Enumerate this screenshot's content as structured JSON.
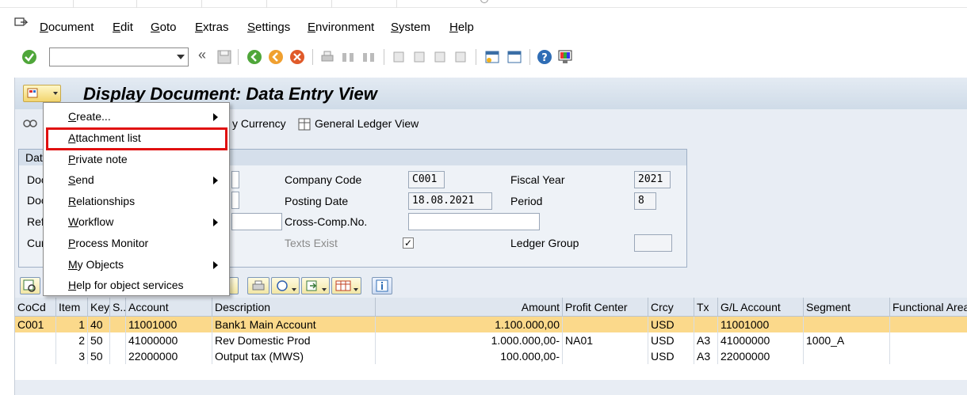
{
  "menu": {
    "items": [
      "Document",
      "Edit",
      "Goto",
      "Extras",
      "Settings",
      "Environment",
      "System",
      "Help"
    ]
  },
  "toolbar": {
    "command_field_value": ""
  },
  "page": {
    "title": "Display Document: Data Entry View"
  },
  "appbar": {
    "currency_label": "y Currency",
    "gl_view_label": "General Ledger View"
  },
  "header": {
    "group_title": "Dat",
    "left_labels": [
      "Doc",
      "Doc",
      "Ref",
      "Cur"
    ],
    "company_code_label": "Company Code",
    "company_code_value": "C001",
    "posting_date_label": "Posting Date",
    "posting_date_value": "18.08.2021",
    "cross_comp_label": "Cross-Comp.No.",
    "cross_comp_value": "",
    "texts_exist_label": "Texts Exist",
    "texts_exist_checked": "✓",
    "fiscal_year_label": "Fiscal Year",
    "fiscal_year_value": "2021",
    "period_label": "Period",
    "period_value": "8",
    "ledger_group_label": "Ledger Group",
    "ledger_group_value": ""
  },
  "table": {
    "columns": [
      "CoCd",
      "Item",
      "Key",
      "S...",
      "Account",
      "Description",
      "Amount",
      "Profit Center",
      "Crcy",
      "Tx",
      "G/L Account",
      "Segment",
      "Functional Area"
    ],
    "rows": [
      {
        "cocd": "C001",
        "item": "1",
        "key": "40",
        "s": "",
        "account": "11001000",
        "description": "Bank1 Main Account",
        "amount": "1.100.000,00",
        "profit_center": "",
        "crcy": "USD",
        "tx": "",
        "gl_account": "11001000",
        "segment": "",
        "func_area": ""
      },
      {
        "cocd": "",
        "item": "2",
        "key": "50",
        "s": "",
        "account": "41000000",
        "description": "Rev Domestic Prod",
        "amount": "1.000.000,00-",
        "profit_center": "NA01",
        "crcy": "USD",
        "tx": "A3",
        "gl_account": "41000000",
        "segment": "1000_A",
        "func_area": ""
      },
      {
        "cocd": "",
        "item": "3",
        "key": "50",
        "s": "",
        "account": "22000000",
        "description": "Output tax (MWS)",
        "amount": "100.000,00-",
        "profit_center": "",
        "crcy": "USD",
        "tx": "A3",
        "gl_account": "22000000",
        "segment": "",
        "func_area": ""
      }
    ]
  },
  "context_menu": {
    "items": [
      {
        "label": "Create...",
        "submenu": true
      },
      {
        "label": "Attachment list",
        "submenu": false
      },
      {
        "label": "Private note",
        "submenu": false
      },
      {
        "label": "Send",
        "submenu": true
      },
      {
        "label": "Relationships",
        "submenu": false
      },
      {
        "label": "Workflow",
        "submenu": true
      },
      {
        "label": "Process Monitor",
        "submenu": false
      },
      {
        "label": "My Objects",
        "submenu": true
      },
      {
        "label": "Help for object services",
        "submenu": false
      }
    ],
    "highlighted_index": 1
  },
  "colors": {
    "selected_row": "#fbd98b",
    "highlight_border": "#e01010",
    "panel_bg": "#e8edf4"
  }
}
